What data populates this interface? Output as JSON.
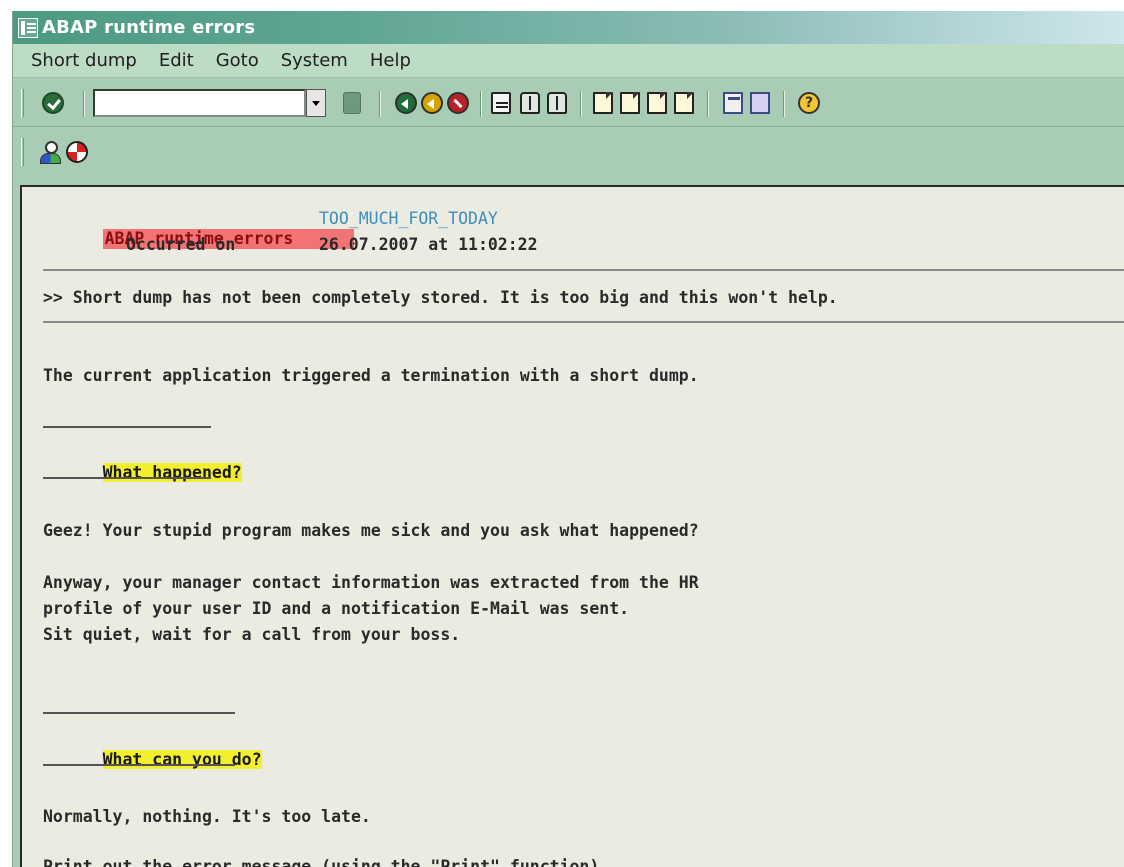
{
  "window": {
    "title": "ABAP runtime errors"
  },
  "menu": {
    "items": [
      "Short dump",
      "Edit",
      "Goto",
      "System",
      "Help"
    ]
  },
  "toolbar": {
    "command_value": "",
    "icons": [
      "enter-icon",
      "save-icon",
      "back-icon",
      "exit-icon",
      "cancel-icon",
      "print-icon",
      "find-icon",
      "find-next-icon",
      "first-page-icon",
      "previous-page-icon",
      "next-page-icon",
      "last-page-icon",
      "new-session-icon",
      "shortcut-icon",
      "help-icon"
    ]
  },
  "app_toolbar": {
    "icons": [
      "user-icon",
      "debugger-icon"
    ]
  },
  "dump": {
    "header_label": "ABAP runtime errors",
    "error_name": "TOO_MUCH_FOR_TODAY",
    "occurred_label": "Occurred on",
    "occurred_value": "26.07.2007 at 11:02:22",
    "storage_note": ">> Short dump has not been completely stored. It is too big and this won't help.",
    "intro": "The current application triggered a termination with a short dump.",
    "section1_title": "What happened?",
    "section1_line1": "Geez! Your stupid program makes me sick and you ask what happened?",
    "section1_para2_line1": "Anyway, your manager contact information was extracted from the HR",
    "section1_para2_line2": "profile of your user ID and a notification E-Mail was sent.",
    "section1_para2_line3": "Sit quiet, wait for a call from your boss.",
    "section2_title": "What can you do?",
    "section2_line1": "Normally, nothing. It's too late.",
    "section2_line2": "Print out the error message (using the \"Print\" function)"
  },
  "colors": {
    "titlebar": "#4c9a82",
    "menubar": "#bcdcc4",
    "toolbar": "#a9cdb4",
    "content_bg": "#ecebe2",
    "header_red": "#f27373",
    "teal_text": "#3c8fbd",
    "highlight_yellow": "#f4ef2e"
  }
}
